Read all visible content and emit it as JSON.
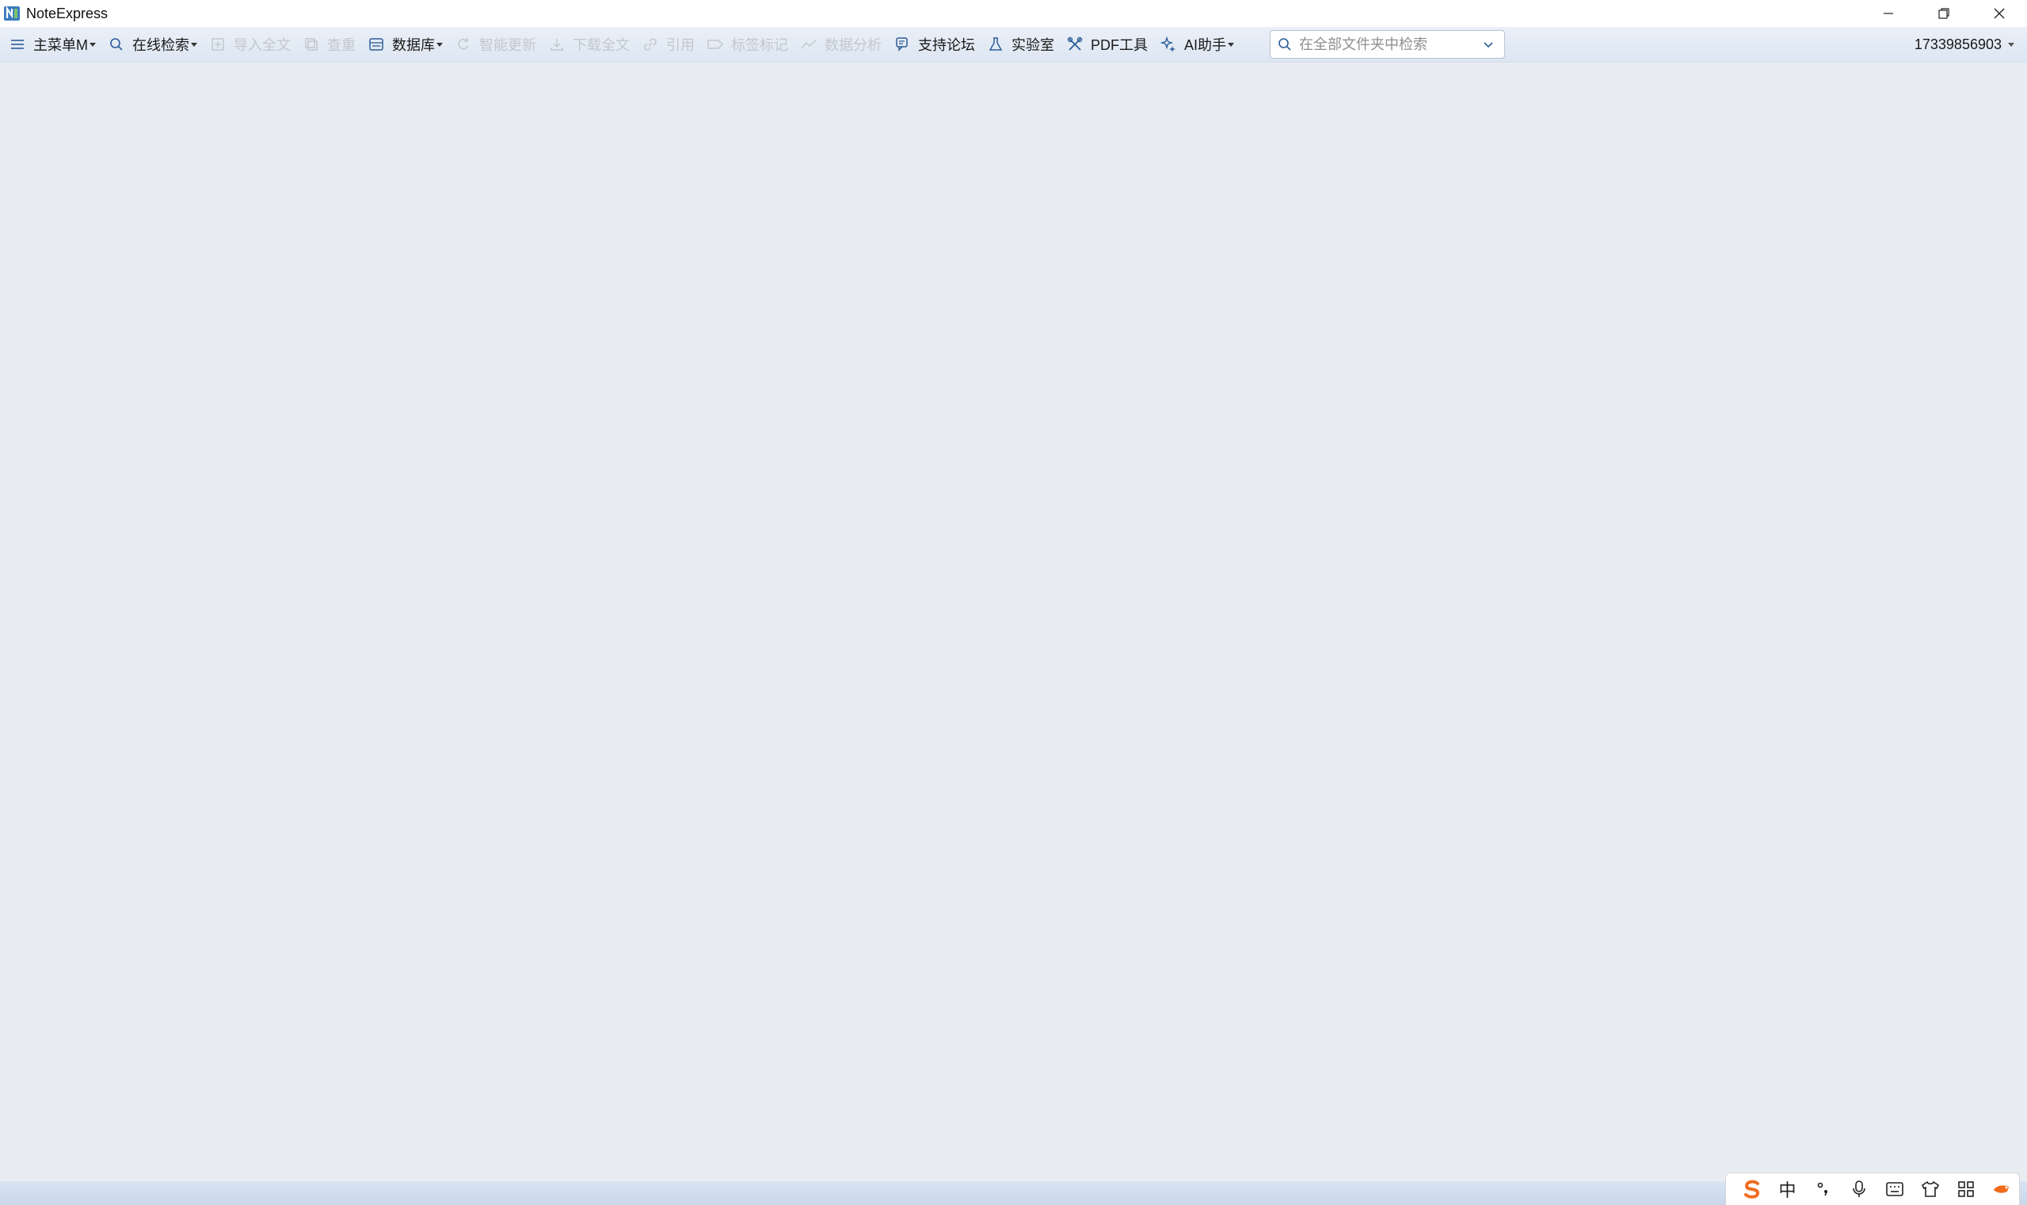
{
  "window": {
    "title": "NoteExpress",
    "controls": {
      "minimize": "minimize-icon",
      "restore": "restore-icon",
      "close": "close-icon"
    }
  },
  "toolbar": {
    "items": [
      {
        "label": "主菜单M",
        "icon": "hamburger-icon",
        "dropdown": true,
        "enabled": true
      },
      {
        "label": "在线检索",
        "icon": "search-icon",
        "dropdown": true,
        "enabled": true
      },
      {
        "label": "导入全文",
        "icon": "import-icon",
        "dropdown": false,
        "enabled": false
      },
      {
        "label": "查重",
        "icon": "duplicate-icon",
        "dropdown": false,
        "enabled": false
      },
      {
        "label": "数据库",
        "icon": "database-icon",
        "dropdown": true,
        "enabled": true
      },
      {
        "label": "智能更新",
        "icon": "refresh-icon",
        "dropdown": false,
        "enabled": false
      },
      {
        "label": "下载全文",
        "icon": "download-icon",
        "dropdown": false,
        "enabled": false
      },
      {
        "label": "引用",
        "icon": "link-icon",
        "dropdown": false,
        "enabled": false
      },
      {
        "label": "标签标记",
        "icon": "tag-icon",
        "dropdown": false,
        "enabled": false
      },
      {
        "label": "数据分析",
        "icon": "chart-icon",
        "dropdown": false,
        "enabled": false
      },
      {
        "label": "支持论坛",
        "icon": "forum-icon",
        "dropdown": false,
        "enabled": true
      },
      {
        "label": "实验室",
        "icon": "flask-icon",
        "dropdown": false,
        "enabled": true
      },
      {
        "label": "PDF工具",
        "icon": "tools-icon",
        "dropdown": false,
        "enabled": true
      },
      {
        "label": "AI助手",
        "icon": "ai-icon",
        "dropdown": true,
        "enabled": true
      }
    ],
    "search": {
      "placeholder": "在全部文件夹中检索",
      "value": ""
    },
    "user": "17339856903"
  },
  "ime": {
    "items": [
      "sogou-logo-icon",
      "中",
      "punctuation-icon",
      "microphone-icon",
      "keyboard-icon",
      "skin-icon",
      "grid-icon",
      "extra-icon"
    ],
    "mode_label": "中"
  },
  "colors": {
    "background": "#e9edf1",
    "toolbar": "#e3eaf5",
    "disabled_text": "#c2c8d0",
    "sogou_orange": "#f26b1d"
  }
}
